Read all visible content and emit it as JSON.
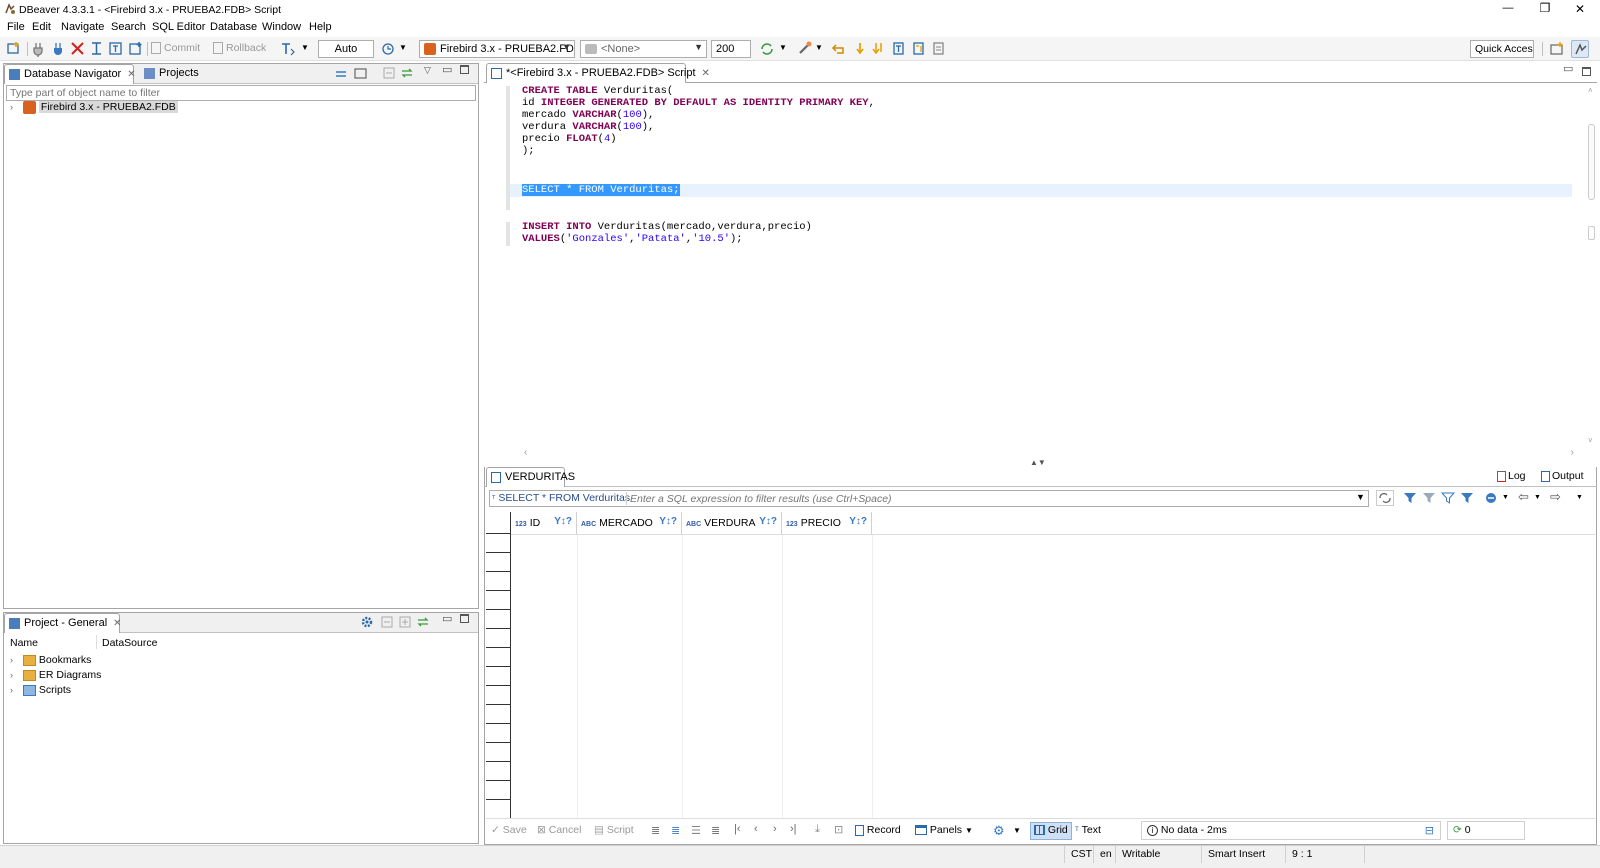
{
  "window": {
    "title": "DBeaver 4.3.3.1 - <Firebird 3.x - PRUEBA2.FDB> Script",
    "minimize": "—",
    "restore": "❐",
    "close": "✕"
  },
  "menu": [
    "File",
    "Edit",
    "Navigate",
    "Search",
    "SQL Editor",
    "Database",
    "Window",
    "Help"
  ],
  "toolbar": {
    "commit": "Commit",
    "rollback": "Rollback",
    "transaction_mode": "Auto",
    "connection": "Firebird 3.x - PRUEBA2.FDB",
    "schema": "<None>",
    "result_limit": "200",
    "quick_access": "Quick Access"
  },
  "navigator": {
    "tab_label": "Database Navigator",
    "projects_tab": "Projects",
    "filter_placeholder": "Type part of object name to filter",
    "tree": [
      {
        "label": "Firebird 3.x - PRUEBA2.FDB"
      }
    ]
  },
  "project": {
    "tab_label": "Project - General",
    "col_name": "Name",
    "col_datasource": "DataSource",
    "items": [
      {
        "label": "Bookmarks",
        "icon": "bookmarks-icon"
      },
      {
        "label": "ER Diagrams",
        "icon": "er-diagram-icon"
      },
      {
        "label": "Scripts",
        "icon": "scripts-icon"
      }
    ]
  },
  "editor": {
    "tab_label": "*<Firebird 3.x - PRUEBA2.FDB> Script",
    "lines": [
      "CREATE TABLE Verduritas(",
      "id INTEGER GENERATED BY DEFAULT AS IDENTITY PRIMARY KEY,",
      "mercado VARCHAR(100),",
      "verdura VARCHAR(100),",
      "precio FLOAT(4)",
      ");",
      "",
      "",
      "SELECT * FROM Verduritas;",
      "",
      "",
      "INSERT INTO Verduritas(mercado,verdura,precio)",
      "VALUES('Gonzales','Patata','10.5');"
    ]
  },
  "results": {
    "tab_label": "VERDURITAS",
    "log_label": "Log",
    "output_label": "Output",
    "query_label": "SELECT * FROM Verduritas",
    "filter_placeholder": "Enter a SQL expression to filter results (use Ctrl+Space)",
    "columns": [
      {
        "type": "123",
        "name": "ID"
      },
      {
        "type": "ABC",
        "name": "MERCADO"
      },
      {
        "type": "ABC",
        "name": "VERDURA"
      },
      {
        "type": "123",
        "name": "PRECIO"
      }
    ],
    "bottom": {
      "save": "Save",
      "cancel": "Cancel",
      "script": "Script",
      "record": "Record",
      "panels": "Panels",
      "grid": "Grid",
      "text": "Text",
      "status": "No data - 2ms",
      "count": "0"
    }
  },
  "statusbar": {
    "timezone": "CST",
    "locale": "en",
    "mode": "Writable",
    "insert": "Smart Insert",
    "position": "9 : 1"
  },
  "colors": {
    "selection": "#3399ff",
    "line_highlight": "#e8f2fe",
    "keyword": "#7f0055",
    "string": "#2a00ff"
  }
}
